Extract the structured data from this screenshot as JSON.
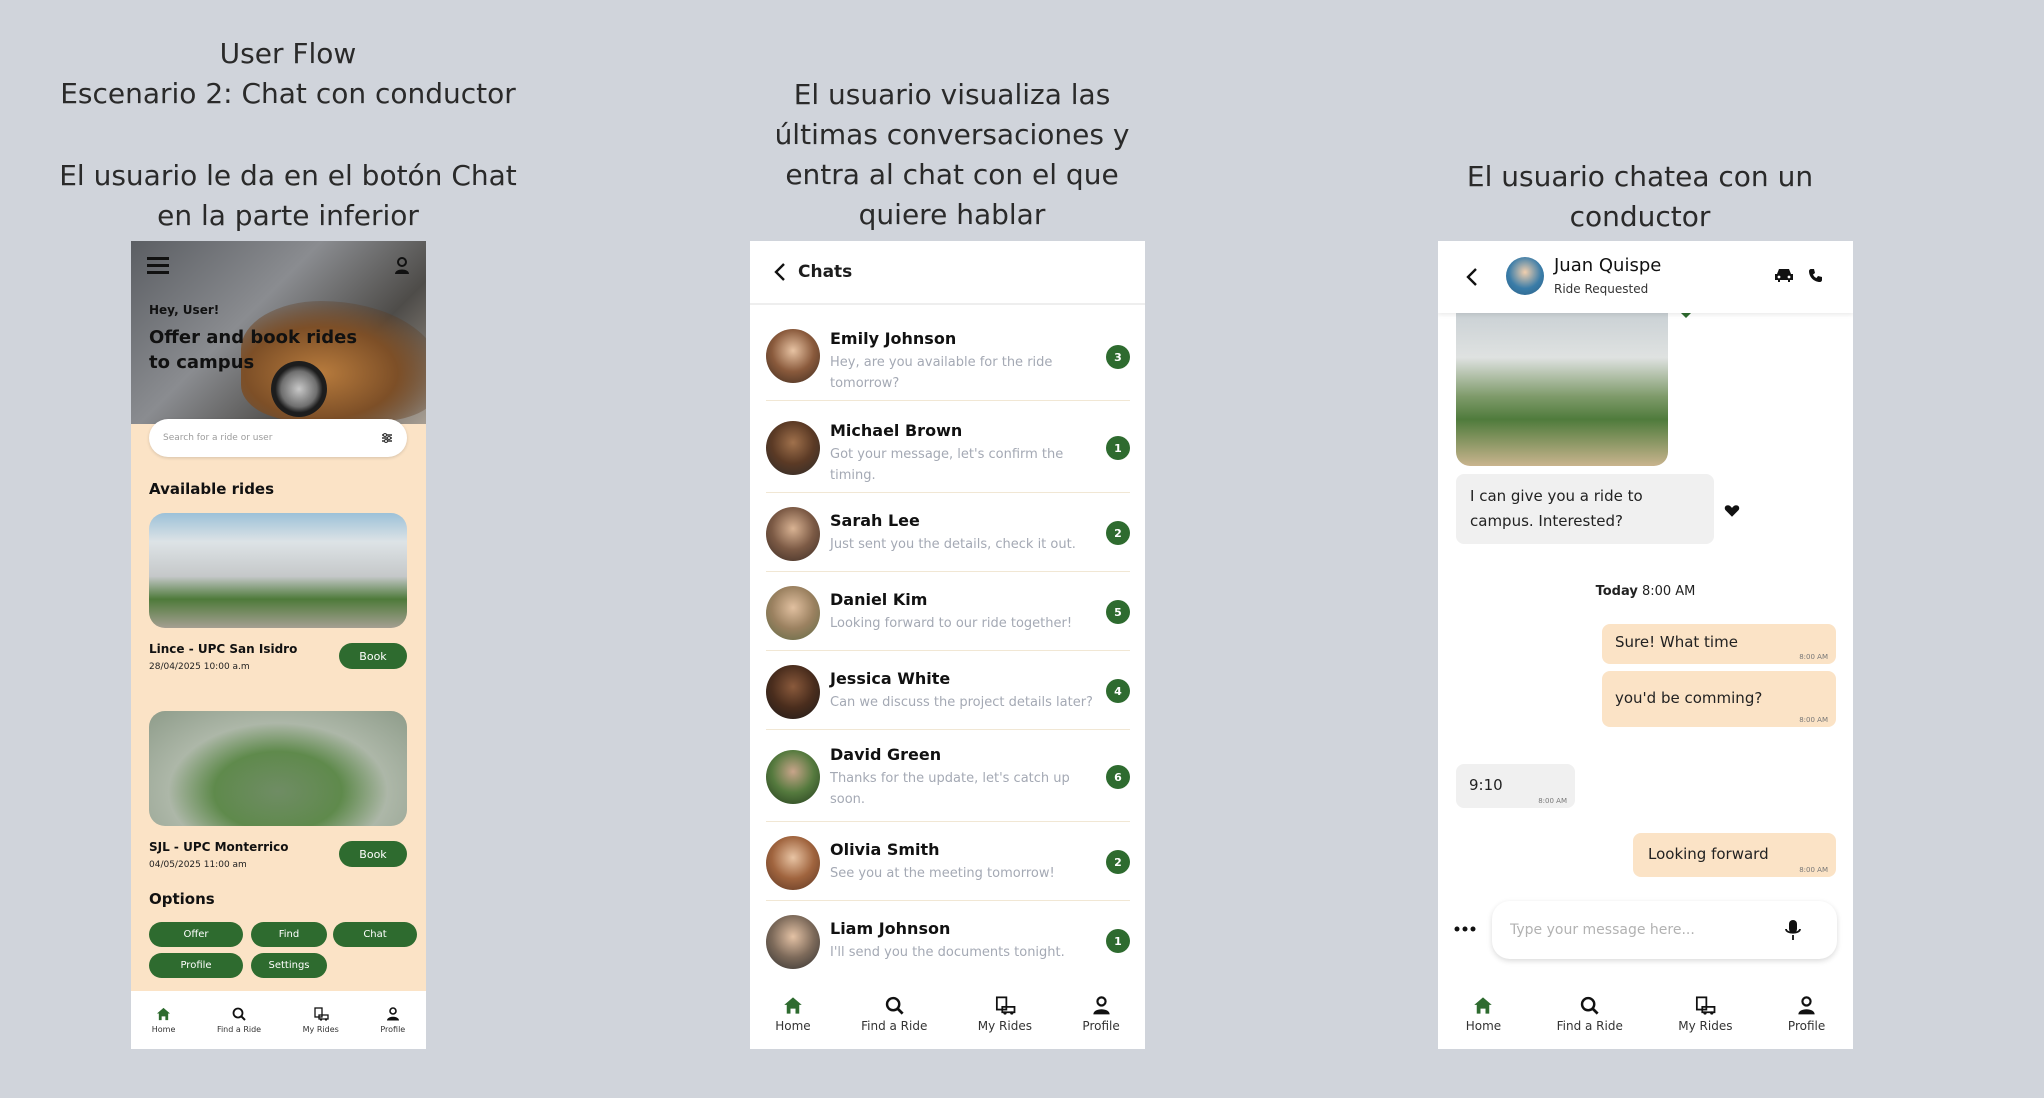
{
  "captions": {
    "left": [
      "User Flow",
      "Escenario 2: Chat con conductor",
      "",
      "El usuario le da en el botón Chat",
      "en la parte inferior"
    ],
    "middle": [
      "El usuario visualiza las",
      "últimas conversaciones y",
      "entra al chat con el que",
      "quiere hablar"
    ],
    "right": [
      "El usuario chatea con un",
      "conductor"
    ]
  },
  "home": {
    "greeting": "Hey, User!",
    "headline": "Offer and book rides to campus",
    "search_placeholder": "Search for a ride or user",
    "section_available": "Available rides",
    "rides": [
      {
        "route": "Lince - UPC San Isidro",
        "datetime": "28/04/2025 10:00 a.m",
        "book_label": "Book"
      },
      {
        "route": "SJL - UPC Monterrico",
        "datetime": "04/05/2025 11:00 am",
        "book_label": "Book"
      }
    ],
    "section_options": "Options",
    "options": [
      "Offer",
      "Find",
      "Chat",
      "Profile",
      "Settings"
    ]
  },
  "nav": {
    "home": "Home",
    "find": "Find a Ride",
    "rides": "My Rides",
    "profile": "Profile"
  },
  "chats": {
    "title": "Chats",
    "items": [
      {
        "name": "Emily Johnson",
        "message": "Hey, are you available for the ride tomorrow?",
        "unread": "3"
      },
      {
        "name": "Michael Brown",
        "message": "Got your message, let's confirm the timing.",
        "unread": "1"
      },
      {
        "name": "Sarah Lee",
        "message": "Just sent you the details, check it out.",
        "unread": "2"
      },
      {
        "name": "Daniel Kim",
        "message": "Looking forward to our ride together!",
        "unread": "5"
      },
      {
        "name": "Jessica White",
        "message": "Can we discuss the project details later?",
        "unread": "4"
      },
      {
        "name": "David Green",
        "message": "Thanks for the update, let's catch up soon.",
        "unread": "6"
      },
      {
        "name": "Olivia Smith",
        "message": "See you at the meeting tomorrow!",
        "unread": "2"
      },
      {
        "name": "Liam Johnson",
        "message": "I'll send you the documents tonight.",
        "unread": "1"
      }
    ]
  },
  "conversation": {
    "contact_name": "Juan Quispe",
    "contact_status": "Ride Requested",
    "messages": {
      "offer": "I can give you a ride to campus. Interested?",
      "day_label": "Today",
      "day_time": "8:00 AM",
      "m1": "Sure! What time",
      "m1_time": "8:00 AM",
      "m2": "you'd be comming?",
      "m2_time": "8:00 AM",
      "m3": "9:10",
      "m3_time": "8:00 AM",
      "m4": "Looking forward",
      "m4_time": "8:00 AM"
    },
    "input_placeholder": "Type your message here..."
  },
  "colors": {
    "background": "#d0d4db",
    "accent_green": "#2e6b2f",
    "peach": "#fbe3c6",
    "muted_text": "#a4a9b4"
  }
}
